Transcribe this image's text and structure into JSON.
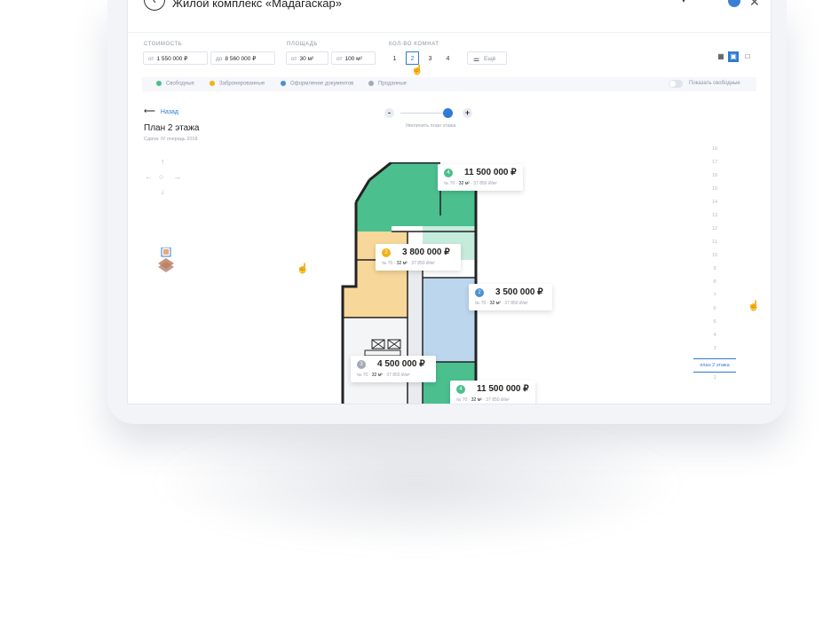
{
  "app": {
    "title": "Жилой комплекс «Мадагаскар»",
    "back_icon": "chevron-left-icon",
    "close_icon": "close-icon"
  },
  "filters": {
    "price": {
      "label": "СТОИМОСТЬ",
      "from_prefix": "от",
      "from": "1 550 000 ₽",
      "to_prefix": "до",
      "to": "8 560 000 ₽"
    },
    "area": {
      "label": "ПЛОЩАДЬ",
      "from_prefix": "от",
      "from": "30 м²",
      "to_prefix": "от",
      "to": "100 м²"
    },
    "rooms": {
      "label": "КОЛ-ВО КОМНАТ",
      "options": [
        "1",
        "2",
        "3",
        "4"
      ],
      "selected": "2"
    },
    "still_label": "Ещё"
  },
  "view_switch": {
    "options": [
      "list-view-icon",
      "grid-view-icon",
      "single-view-icon"
    ],
    "selected": "grid-view-icon"
  },
  "legend": {
    "items": [
      {
        "label": "Свободные",
        "color": "#4cbf8f"
      },
      {
        "label": "Забронированные",
        "color": "#f3b316"
      },
      {
        "label": "Оформление документов",
        "color": "#4a90d4"
      },
      {
        "label": "Проданные",
        "color": "#a5a9b3"
      }
    ],
    "toggle_label": "Показать свободные"
  },
  "nav": {
    "back_label": "Назад"
  },
  "plan": {
    "title": "План 2 этажа",
    "subtitle": "Сдача: IV очередь 2018"
  },
  "zoom": {
    "minus": "-",
    "plus": "+",
    "label": "Увеличить план этажа",
    "level": 0.95
  },
  "floors": {
    "items": [
      "16",
      "15",
      "14",
      "13",
      "12",
      "11",
      "10",
      "9",
      "8",
      "7",
      "6",
      "5",
      "4",
      "3",
      "2",
      "1"
    ],
    "top_item": "17",
    "active_floor": "2",
    "active_label": "план 2 этажа",
    "highlight_value": "18"
  },
  "apartments": [
    {
      "rooms": "4",
      "price": "11 500 000 ₽",
      "number": "№ 70",
      "area": "32 м²",
      "ppm": "37 850 ₽/м²",
      "status_color": "#4cbf8f"
    },
    {
      "rooms": "2",
      "price": "3 800 000 ₽",
      "number": "№ 70",
      "area": "32 м²",
      "ppm": "37 850 ₽/м²",
      "status_color": "#f3b316"
    },
    {
      "rooms": "2",
      "price": "3 500 000 ₽",
      "number": "№ 70",
      "area": "32 м²",
      "ppm": "37 850 ₽/м²",
      "status_color": "#4a90d4"
    },
    {
      "rooms": "3",
      "price": "4 500 000 ₽",
      "number": "№ 70",
      "area": "32 м²",
      "ppm": "37 850 ₽/м²",
      "status_color": "#a5a9b3"
    },
    {
      "rooms": "4",
      "price": "11 500 000 ₽",
      "number": "№ 70",
      "area": "32 м²",
      "ppm": "37 850 ₽/м²",
      "status_color": "#4cbf8f"
    }
  ]
}
